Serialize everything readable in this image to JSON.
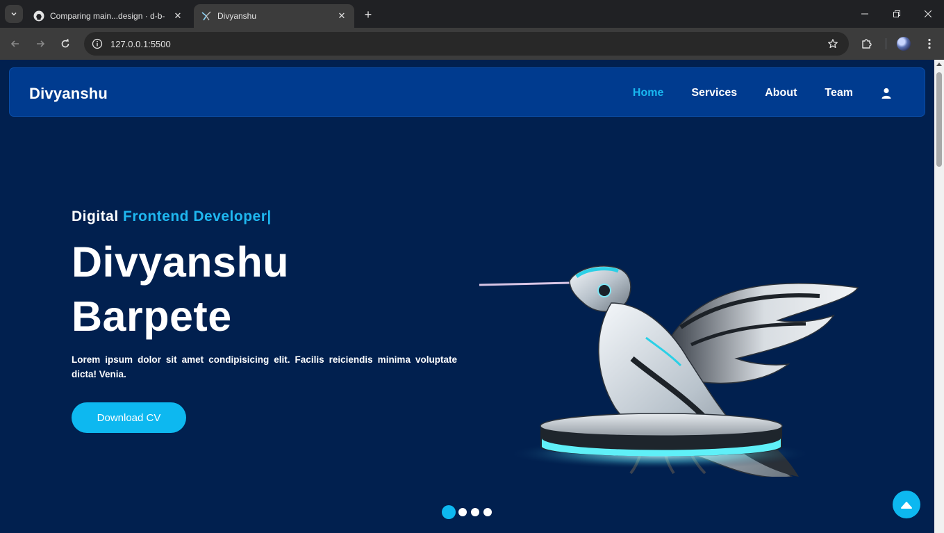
{
  "browser": {
    "tabs": [
      {
        "title": "Comparing main...design · d-b-",
        "icon": "github-icon",
        "active": false
      },
      {
        "title": "Divyanshu",
        "icon": "site-favicon-icon",
        "active": true
      }
    ],
    "url": "127.0.0.1:5500"
  },
  "site": {
    "brand": "Divyanshu",
    "nav": {
      "home": "Home",
      "services": "Services",
      "about": "About",
      "team": "Team"
    }
  },
  "hero": {
    "subtitle_prefix": "Digital ",
    "subtitle_accent": "Frontend Developer",
    "subtitle_cursor": "|",
    "name_line1": "Divyanshu",
    "name_line2": "Barpete",
    "description": "Lorem ipsum dolor sit amet condipisicing elit. Facilis reiciendis minima voluptate dicta! Venia.",
    "cta_label": "Download CV",
    "image_icon": "robotic-hummingbird-on-pedestal"
  },
  "carousel": {
    "total_slides": 4,
    "active_slide": 1
  },
  "colors": {
    "page_bg": "#01204f",
    "nav_bg": "#003b8f",
    "accent": "#0db8f0"
  }
}
